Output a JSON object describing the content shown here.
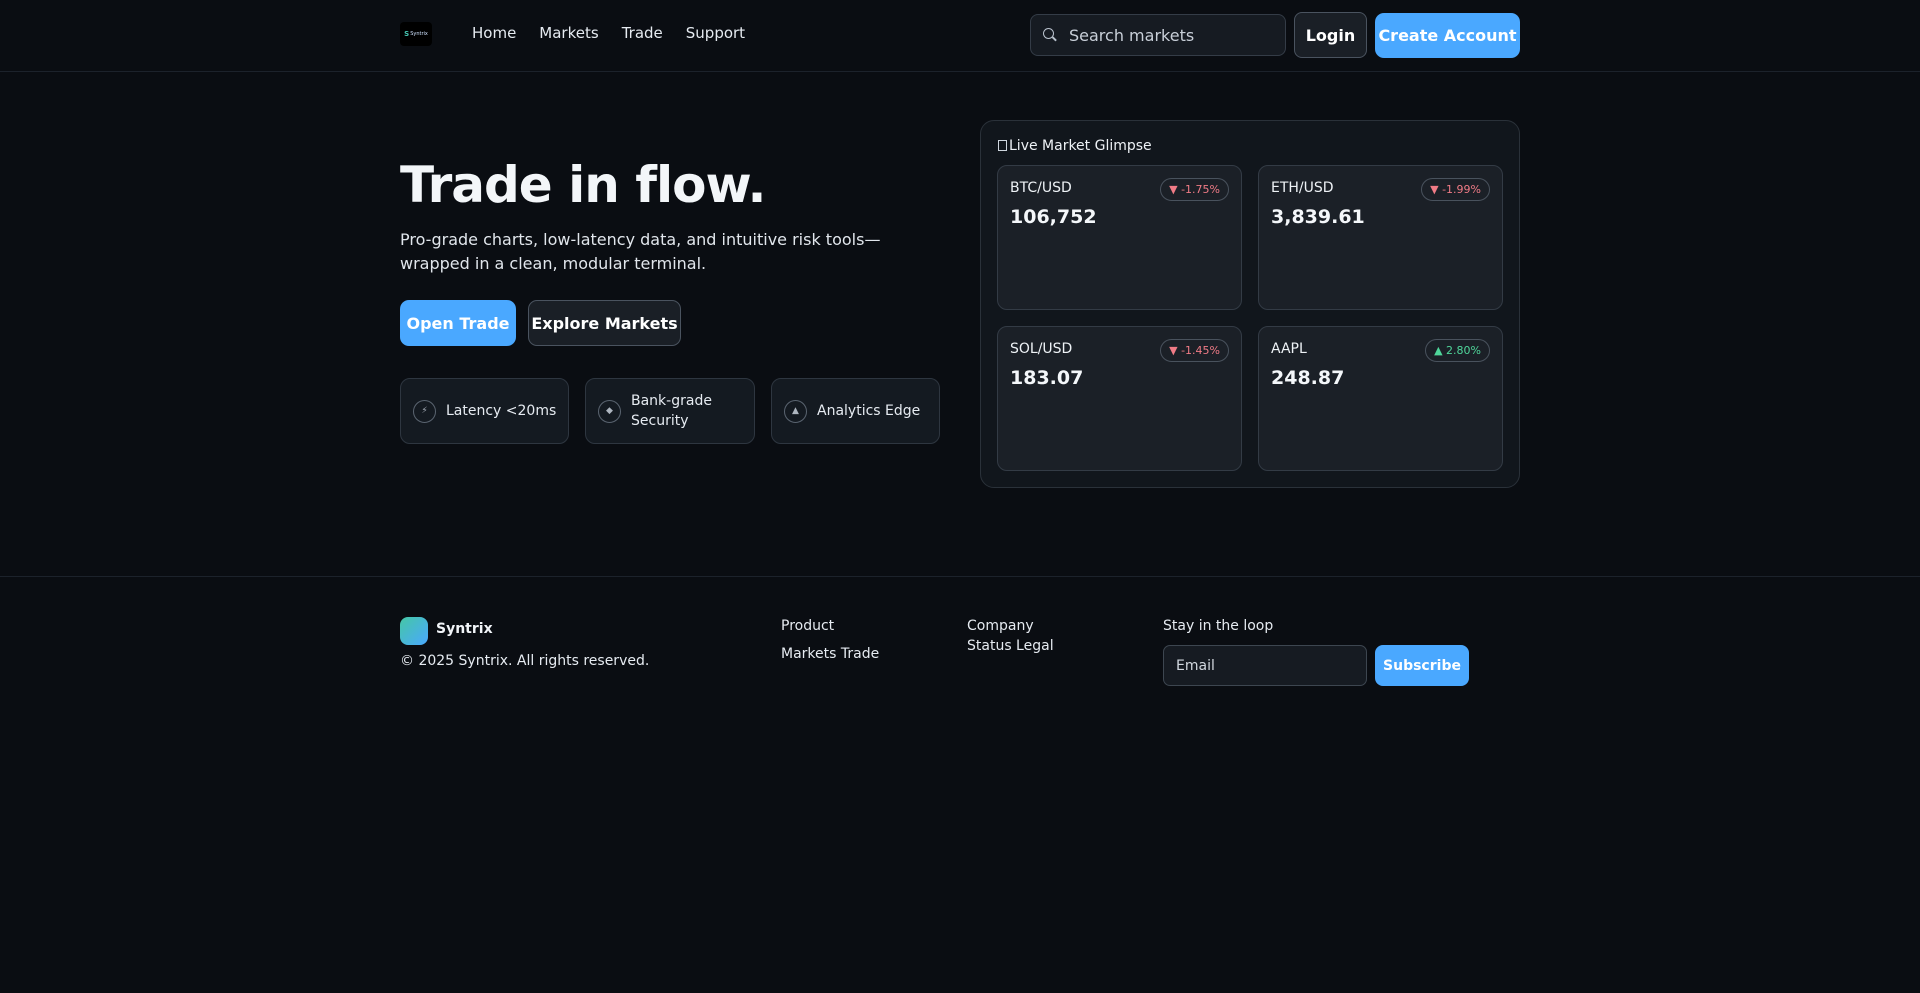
{
  "header": {
    "logo_text": "Syntrix",
    "nav": [
      {
        "label": "Home"
      },
      {
        "label": "Markets"
      },
      {
        "label": "Trade"
      },
      {
        "label": "Support"
      }
    ],
    "search_placeholder": "Search markets",
    "login_label": "Login",
    "create_label": "Create Account"
  },
  "hero": {
    "title": "Trade in flow.",
    "subtitle": "Pro-grade charts, low-latency data, and intuitive risk tools—wrapped in a clean, modular terminal.",
    "open_trade_label": "Open Trade",
    "explore_label": "Explore Markets",
    "features": [
      {
        "label": "Latency <20ms",
        "icon": "bolt-icon"
      },
      {
        "label": "Bank-grade Security",
        "icon": "shield-icon"
      },
      {
        "label": "Analytics Edge",
        "icon": "chart-icon"
      }
    ]
  },
  "market": {
    "title": "Live Market Glimpse",
    "cards": [
      {
        "symbol": "BTC/USD",
        "price": "106,752",
        "change": "▼ -1.75%",
        "direction": "down"
      },
      {
        "symbol": "ETH/USD",
        "price": "3,839.61",
        "change": "▼ -1.99%",
        "direction": "down"
      },
      {
        "symbol": "SOL/USD",
        "price": "183.07",
        "change": "▼ -1.45%",
        "direction": "down"
      },
      {
        "symbol": "AAPL",
        "price": "248.87",
        "change": "▲ 2.80%",
        "direction": "up"
      }
    ]
  },
  "footer": {
    "brand": "Syntrix",
    "copyright": "© 2025 Syntrix. All rights reserved.",
    "product_heading": "Product",
    "product_links": "Markets Trade",
    "company_heading": "Company",
    "company_links": "Status Legal",
    "newsletter_heading": "Stay in the loop",
    "email_placeholder": "Email",
    "subscribe_label": "Subscribe"
  },
  "colors": {
    "background": "#0a0d12",
    "accent": "#4aa8ff",
    "down": "#f07b86",
    "up": "#4fd69a"
  }
}
